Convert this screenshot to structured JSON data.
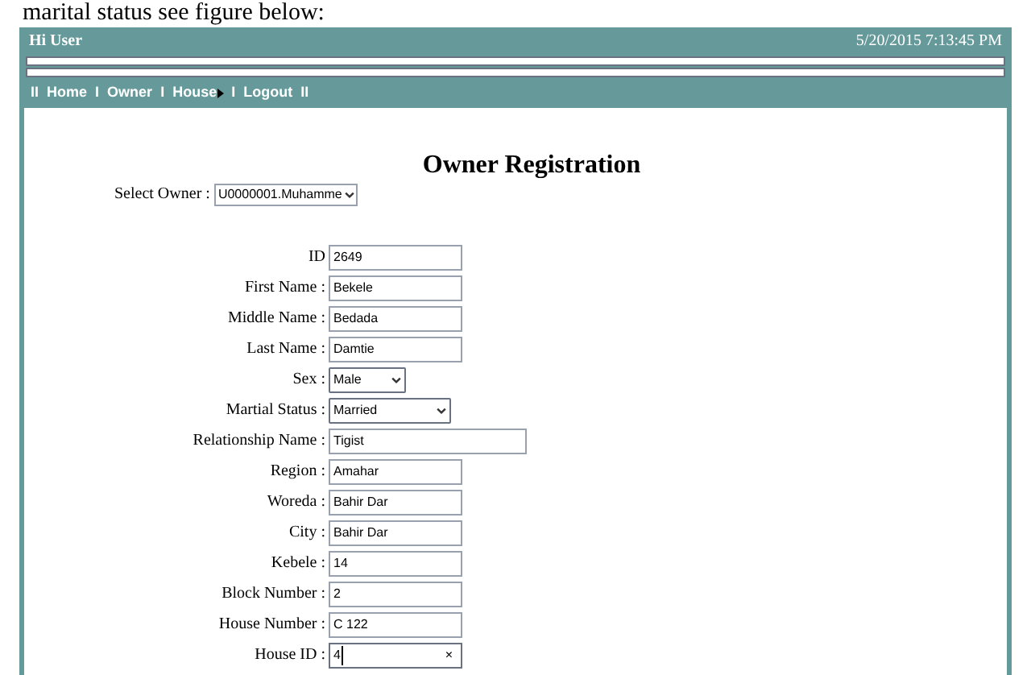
{
  "caption": "marital status see figure below:",
  "header": {
    "greeting": "Hi User",
    "datetime": "5/20/2015 7:13:45 PM"
  },
  "nav": {
    "items": [
      {
        "sep": "II",
        "label": "Home"
      },
      {
        "sep": "I",
        "label": "Owner"
      },
      {
        "sep": "I",
        "label": "House",
        "submenu": true
      },
      {
        "sep": "I",
        "label": "Logout"
      }
    ],
    "end": "II"
  },
  "title": "Owner Registration",
  "select_owner": {
    "label": "Select Owner :",
    "value": "U0000001.Muhamme"
  },
  "fields": [
    {
      "kind": "text",
      "label": "ID",
      "value": "2649"
    },
    {
      "kind": "text",
      "label": "First Name :",
      "value": "Bekele"
    },
    {
      "kind": "text",
      "label": "Middle Name :",
      "value": "Bedada"
    },
    {
      "kind": "text",
      "label": "Last Name :",
      "value": "Damtie"
    },
    {
      "kind": "shortselect",
      "label": "Sex :",
      "value": "Male"
    },
    {
      "kind": "select",
      "label": "Martial Status :",
      "value": "Married"
    },
    {
      "kind": "widetext",
      "label": "Relationship Name :",
      "value": "Tigist"
    },
    {
      "kind": "text",
      "label": "Region :",
      "value": "Amahar"
    },
    {
      "kind": "text",
      "label": "Woreda :",
      "value": "Bahir Dar"
    },
    {
      "kind": "text",
      "label": "City :",
      "value": "Bahir Dar"
    },
    {
      "kind": "text",
      "label": "Kebele :",
      "value": "14"
    },
    {
      "kind": "text",
      "label": "Block Number :",
      "value": "2"
    },
    {
      "kind": "text",
      "label": "House Number :",
      "value": "C 122"
    },
    {
      "kind": "search",
      "label": "House ID :",
      "value": "4",
      "clear": "×"
    }
  ]
}
